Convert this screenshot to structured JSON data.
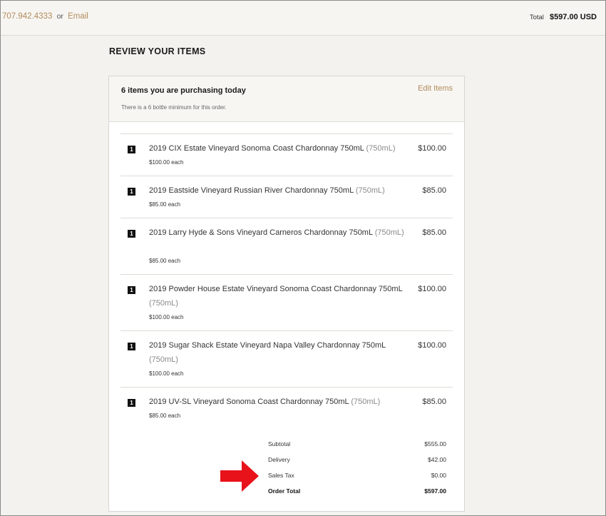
{
  "header": {
    "phone": "707.942.4333",
    "or": "or",
    "email": "Email",
    "total_label": "Total",
    "total_value": "$597.00 USD"
  },
  "section_title": "REVIEW YOUR ITEMS",
  "card": {
    "count": "6 items you are purchasing today",
    "note": "There is a 6 bottle minimum for this order.",
    "edit": "Edit Items"
  },
  "items": [
    {
      "qty": "1",
      "name": "2019 CIX Estate Vineyard Sonoma Coast Chardonnay 750mL",
      "size": "(750mL)",
      "each": "$100.00 each",
      "price": "$100.00"
    },
    {
      "qty": "1",
      "name": "2019 Eastside Vineyard Russian River Chardonnay 750mL",
      "size": "(750mL)",
      "each": "$85.00 each",
      "price": "$85.00"
    },
    {
      "qty": "1",
      "name": "2019 Larry Hyde & Sons Vineyard Carneros Chardonnay 750mL",
      "size": "(750mL)",
      "each": "$85.00 each",
      "price": "$85.00"
    },
    {
      "qty": "1",
      "name": "2019 Powder House Estate Vineyard Sonoma Coast Chardonnay 750mL",
      "size": "(750mL)",
      "each": "$100.00 each",
      "price": "$100.00"
    },
    {
      "qty": "1",
      "name": "2019 Sugar Shack Estate Vineyard Napa Valley Chardonnay 750mL",
      "size": "(750mL)",
      "each": "$100.00 each",
      "price": "$100.00"
    },
    {
      "qty": "1",
      "name": "2019 UV-SL Vineyard Sonoma Coast Chardonnay 750mL",
      "size": "(750mL)",
      "each": "$85.00 each",
      "price": "$85.00"
    }
  ],
  "totals": {
    "subtotal_label": "Subtotal",
    "subtotal": "$555.00",
    "delivery_label": "Delivery",
    "delivery": "$42.00",
    "tax_label": "Sales Tax",
    "tax": "$0.00",
    "order_total_label": "Order Total",
    "order_total": "$597.00"
  },
  "colors": {
    "accent": "#b48c5c",
    "arrow": "#e8121b"
  },
  "icons": {
    "annotation": "red-arrow-icon"
  }
}
